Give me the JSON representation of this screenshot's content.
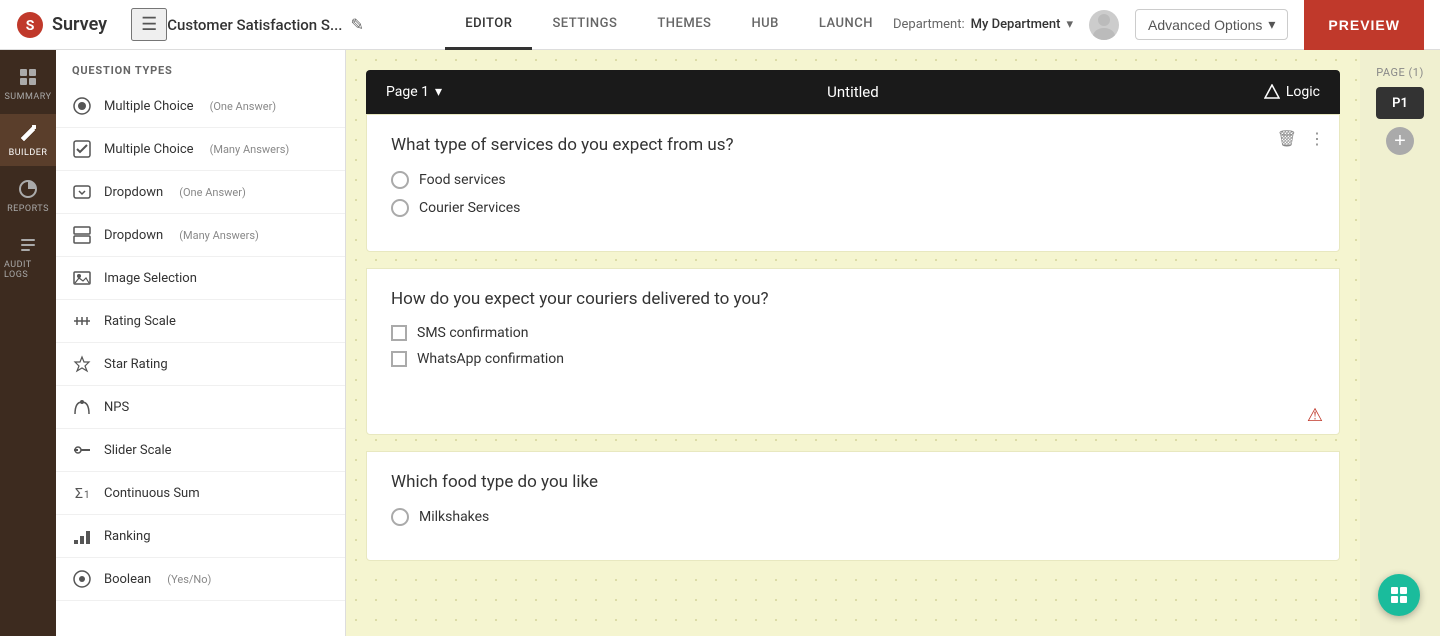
{
  "app": {
    "name": "Survey",
    "logo_color": "#c0392b"
  },
  "topbar": {
    "hamburger": "☰",
    "survey_title": "Customer Satisfaction S...",
    "edit_icon": "✎",
    "department_label": "Department:",
    "department_value": "My Department",
    "advanced_options_label": "Advanced Options",
    "chevron": "▾",
    "preview_label": "PREVIEW"
  },
  "nav_tabs": [
    {
      "id": "editor",
      "label": "EDITOR",
      "active": true
    },
    {
      "id": "settings",
      "label": "SETTINGS",
      "active": false
    },
    {
      "id": "themes",
      "label": "THEMES",
      "active": false
    },
    {
      "id": "hub",
      "label": "HUB",
      "active": false
    },
    {
      "id": "launch",
      "label": "LAUNCH",
      "active": false
    }
  ],
  "icon_sidebar": [
    {
      "id": "summary",
      "label": "SUMMARY",
      "active": false,
      "icon": "▦"
    },
    {
      "id": "builder",
      "label": "BUILDER",
      "active": true,
      "icon": "✏"
    },
    {
      "id": "reports",
      "label": "REPORTS",
      "active": false,
      "icon": "◷"
    },
    {
      "id": "audit_logs",
      "label": "AUDIT LOGS",
      "active": false,
      "icon": "☰"
    }
  ],
  "question_types": {
    "header": "QUESTION TYPES",
    "items": [
      {
        "id": "mc-one",
        "label": "Multiple Choice",
        "sublabel": "(One Answer)",
        "icon": "radio"
      },
      {
        "id": "mc-many",
        "label": "Multiple Choice",
        "sublabel": "(Many Answers)",
        "icon": "checkbox"
      },
      {
        "id": "dd-one",
        "label": "Dropdown",
        "sublabel": "(One Answer)",
        "icon": "dropdown"
      },
      {
        "id": "dd-many",
        "label": "Dropdown",
        "sublabel": "(Many Answers)",
        "icon": "dropdown-many"
      },
      {
        "id": "img-sel",
        "label": "Image Selection",
        "sublabel": "",
        "icon": "image"
      },
      {
        "id": "rating",
        "label": "Rating Scale",
        "sublabel": "",
        "icon": "rating"
      },
      {
        "id": "star",
        "label": "Star Rating",
        "sublabel": "",
        "icon": "star"
      },
      {
        "id": "nps",
        "label": "NPS",
        "sublabel": "",
        "icon": "nps"
      },
      {
        "id": "slider",
        "label": "Slider Scale",
        "sublabel": "",
        "icon": "slider"
      },
      {
        "id": "cont-sum",
        "label": "Continuous Sum",
        "sublabel": "",
        "icon": "sum"
      },
      {
        "id": "ranking",
        "label": "Ranking",
        "sublabel": "",
        "icon": "ranking"
      },
      {
        "id": "boolean",
        "label": "Boolean",
        "sublabel": "(Yes/No)",
        "icon": "boolean"
      }
    ]
  },
  "canvas": {
    "page_label": "Page 1",
    "page_title": "Untitled",
    "logic_label": "Logic",
    "questions": [
      {
        "id": "q1",
        "type": "multiple-choice-one",
        "text": "What type of services do you expect from us?",
        "options": [
          "Food services",
          "Courier Services"
        ],
        "input_type": "radio",
        "has_warning": false
      },
      {
        "id": "q2",
        "type": "multiple-choice-many",
        "text": "How do you expect your couriers delivered to you?",
        "options": [
          "SMS confirmation",
          "WhatsApp confirmation"
        ],
        "input_type": "checkbox",
        "has_warning": true
      },
      {
        "id": "q3",
        "type": "multiple-choice-one",
        "text": "Which food type do you like",
        "options": [
          "Milkshakes"
        ],
        "input_type": "radio",
        "has_warning": false
      }
    ]
  },
  "right_panel": {
    "label": "PAGE (1)",
    "page_thumb": "P1",
    "add_tooltip": "Add page"
  }
}
